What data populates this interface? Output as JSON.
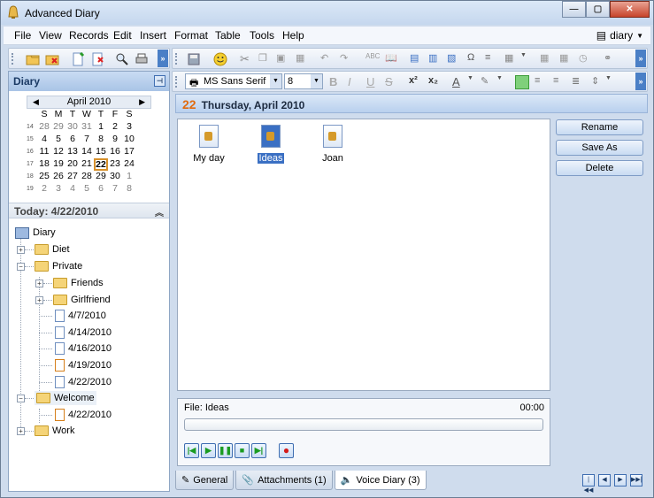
{
  "window": {
    "title": "Advanced Diary"
  },
  "menu": {
    "items": [
      "File",
      "View",
      "Records",
      "Edit",
      "Insert",
      "Format",
      "Table",
      "Tools",
      "Help"
    ],
    "diary_button": "diary"
  },
  "format_bar": {
    "font": "MS Sans Serif",
    "size": "8"
  },
  "sidebar": {
    "title": "Diary",
    "today_label": "Today: 4/22/2010"
  },
  "calendar": {
    "month": "April 2010",
    "weekdays": [
      "S",
      "M",
      "T",
      "W",
      "T",
      "F",
      "S"
    ],
    "weeks": [
      {
        "wk": "14",
        "days": [
          "28",
          "29",
          "30",
          "31",
          "1",
          "2",
          "3"
        ],
        "muted": [
          true,
          true,
          true,
          true,
          false,
          false,
          false
        ]
      },
      {
        "wk": "15",
        "days": [
          "4",
          "5",
          "6",
          "7",
          "8",
          "9",
          "10"
        ],
        "muted": [
          false,
          false,
          false,
          false,
          false,
          false,
          false
        ]
      },
      {
        "wk": "16",
        "days": [
          "11",
          "12",
          "13",
          "14",
          "15",
          "16",
          "17"
        ],
        "muted": [
          false,
          false,
          false,
          false,
          false,
          false,
          false
        ]
      },
      {
        "wk": "17",
        "days": [
          "18",
          "19",
          "20",
          "21",
          "22",
          "23",
          "24"
        ],
        "muted": [
          false,
          false,
          false,
          false,
          false,
          false,
          false
        ]
      },
      {
        "wk": "18",
        "days": [
          "25",
          "26",
          "27",
          "28",
          "29",
          "30",
          "1"
        ],
        "muted": [
          false,
          false,
          false,
          false,
          false,
          false,
          true
        ]
      },
      {
        "wk": "19",
        "days": [
          "2",
          "3",
          "4",
          "5",
          "6",
          "7",
          "8"
        ],
        "muted": [
          true,
          true,
          true,
          true,
          true,
          true,
          true
        ]
      }
    ],
    "today": "22"
  },
  "tree": {
    "root": "Diary",
    "diet": "Diet",
    "private": "Private",
    "friends": "Friends",
    "girlfriend": "Girlfriend",
    "p1": "4/7/2010",
    "p2": "4/14/2010",
    "p3": "4/16/2010",
    "p4": "4/19/2010",
    "p5": "4/22/2010",
    "welcome": "Welcome",
    "w1": "4/22/2010",
    "work": "Work"
  },
  "entry": {
    "day_num": "22",
    "date": "Thursday, April 2010"
  },
  "files": [
    "My day",
    "Ideas",
    "Joan"
  ],
  "actions": {
    "rename": "Rename",
    "save_as": "Save As",
    "delete": "Delete"
  },
  "player": {
    "file": "File: Ideas",
    "time": "00:00"
  },
  "tabs": {
    "general": "General",
    "attachments": "Attachments (1)",
    "voice": "Voice Diary (3)"
  }
}
